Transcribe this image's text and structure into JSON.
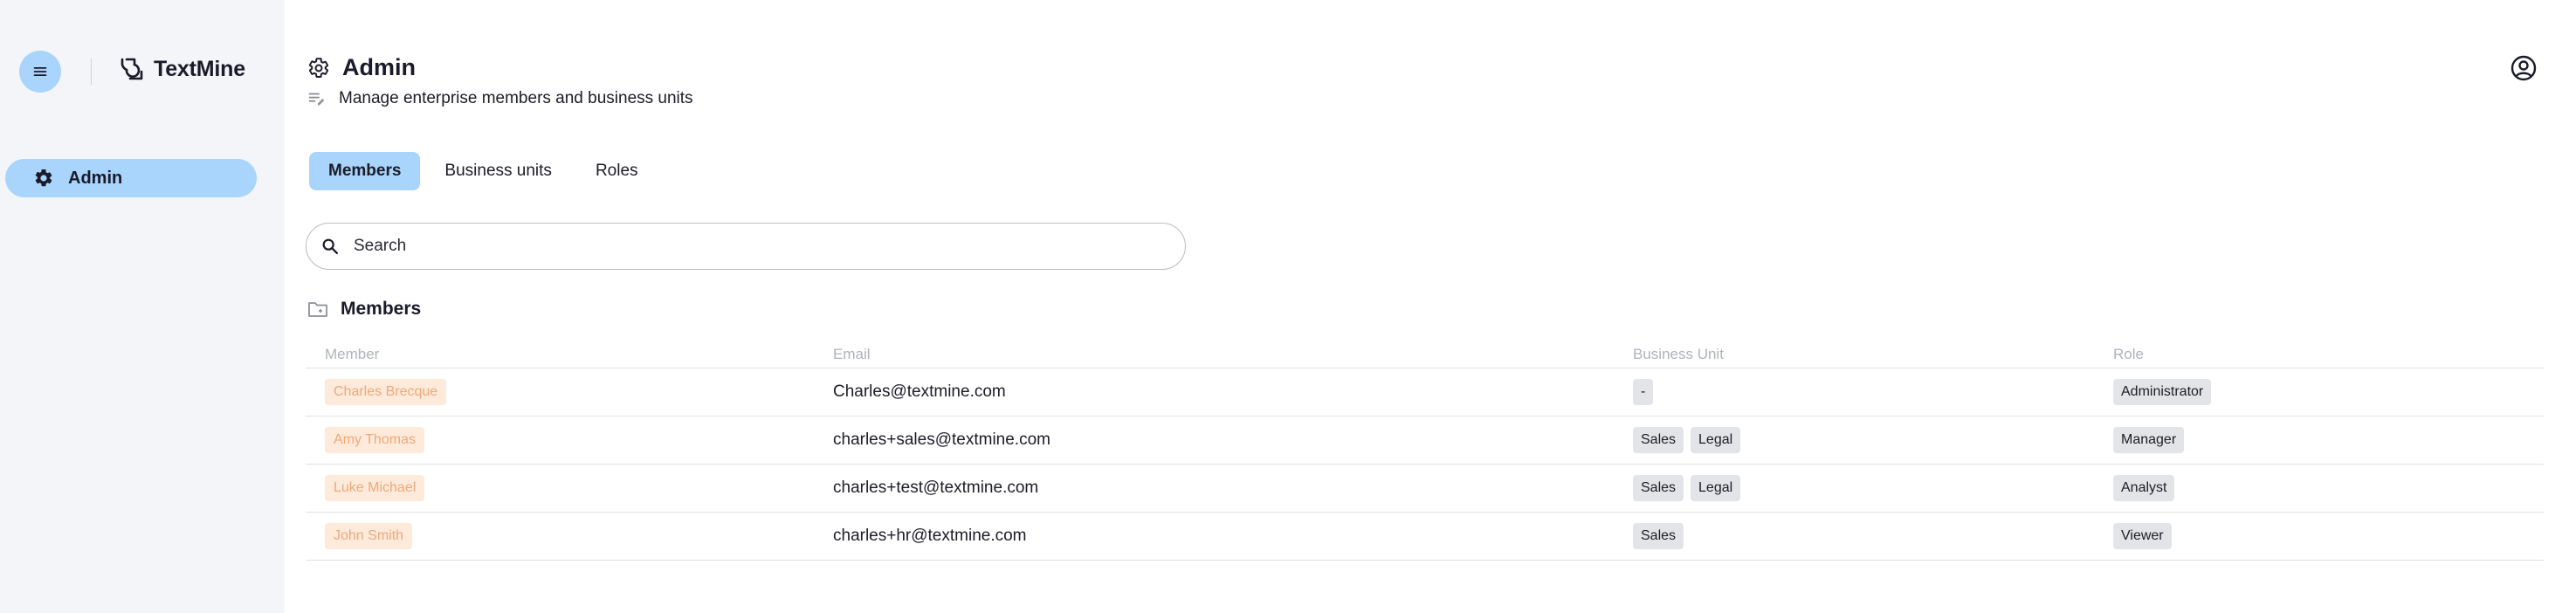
{
  "brand": {
    "name": "TextMine"
  },
  "sidebar": {
    "items": [
      {
        "label": "Admin",
        "icon": "gear-icon"
      }
    ]
  },
  "header": {
    "title": "Admin",
    "subtitle": "Manage enterprise members and business units"
  },
  "tabs": [
    {
      "label": "Members",
      "active": true
    },
    {
      "label": "Business units",
      "active": false
    },
    {
      "label": "Roles",
      "active": false
    }
  ],
  "search": {
    "placeholder": "Search",
    "value": ""
  },
  "section": {
    "title": "Members"
  },
  "table": {
    "columns": [
      "Member",
      "Email",
      "Business Unit",
      "Role"
    ],
    "rows": [
      {
        "member": "Charles Brecque",
        "email": "Charles@textmine.com",
        "units": [
          "-"
        ],
        "role": "Administrator"
      },
      {
        "member": "Amy Thomas",
        "email": "charles+sales@textmine.com",
        "units": [
          "Sales",
          "Legal"
        ],
        "role": "Manager"
      },
      {
        "member": "Luke Michael",
        "email": "charles+test@textmine.com",
        "units": [
          "Sales",
          "Legal"
        ],
        "role": "Analyst"
      },
      {
        "member": "John Smith",
        "email": "charles+hr@textmine.com",
        "units": [
          "Sales"
        ],
        "role": "Viewer"
      }
    ]
  },
  "colors": {
    "accent": "#a9d4fb",
    "sidebar_bg": "#f3f5f9",
    "member_chip_bg": "#fdeadb",
    "member_chip_text": "#f0a878",
    "tag_bg": "#e3e4e7"
  }
}
